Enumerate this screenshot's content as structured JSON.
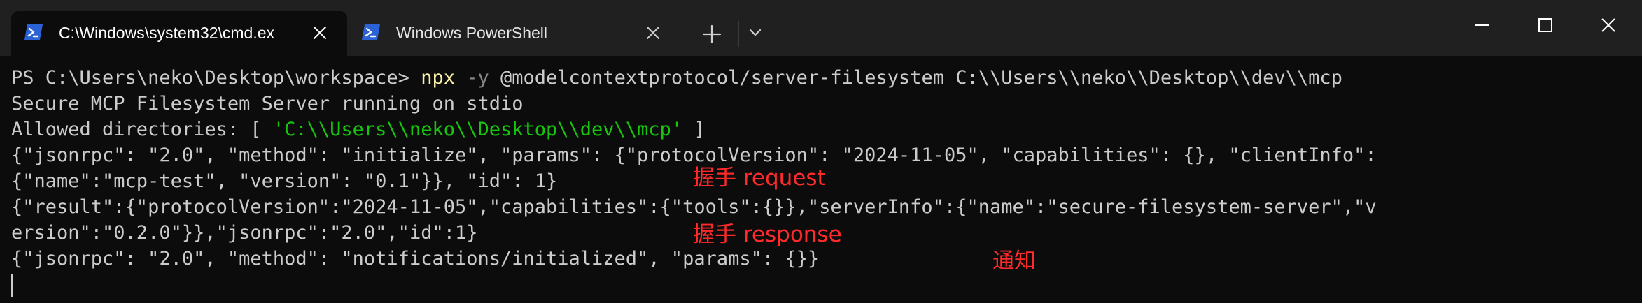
{
  "tabs": [
    {
      "title": "C:\\Windows\\system32\\cmd.ex",
      "active": true,
      "icon": "powershell-icon"
    },
    {
      "title": "Windows PowerShell",
      "active": false,
      "icon": "powershell-icon"
    }
  ],
  "colors": {
    "background": "#0c0c0c",
    "titlebar": "#202020",
    "text": "#cccccc",
    "command": "#f9f1a5",
    "flag": "#8b8b8b",
    "string": "#16c60c",
    "annotation": "#ff2a2a",
    "icon_blue": "#2b63d6"
  },
  "terminal": {
    "line1": {
      "prompt": "PS C:\\Users\\neko\\Desktop\\workspace> ",
      "command": "npx",
      "flag": " -y",
      "args": " @modelcontextprotocol/server-filesystem C:\\\\Users\\\\neko\\\\Desktop\\\\dev\\\\mcp"
    },
    "line2": "Secure MCP Filesystem Server running on stdio",
    "line3": {
      "prefix": "Allowed directories: [ ",
      "path": "'C:\\\\Users\\\\neko\\\\Desktop\\\\dev\\\\mcp'",
      "suffix": " ]"
    },
    "line4": "{\"jsonrpc\": \"2.0\", \"method\": \"initialize\", \"params\": {\"protocolVersion\": \"2024-11-05\", \"capabilities\": {}, \"clientInfo\":",
    "line5": "{\"name\":\"mcp-test\", \"version\": \"0.1\"}}, \"id\": 1}",
    "line6": "{\"result\":{\"protocolVersion\":\"2024-11-05\",\"capabilities\":{\"tools\":{}},\"serverInfo\":{\"name\":\"secure-filesystem-server\",\"v",
    "line7": "ersion\":\"0.2.0\"}},\"jsonrpc\":\"2.0\",\"id\":1}",
    "line8": "{\"jsonrpc\": \"2.0\", \"method\": \"notifications/initialized\", \"params\": {}}"
  },
  "annotations": {
    "request": "握手 request",
    "response": "握手 response",
    "notify": "通知"
  }
}
